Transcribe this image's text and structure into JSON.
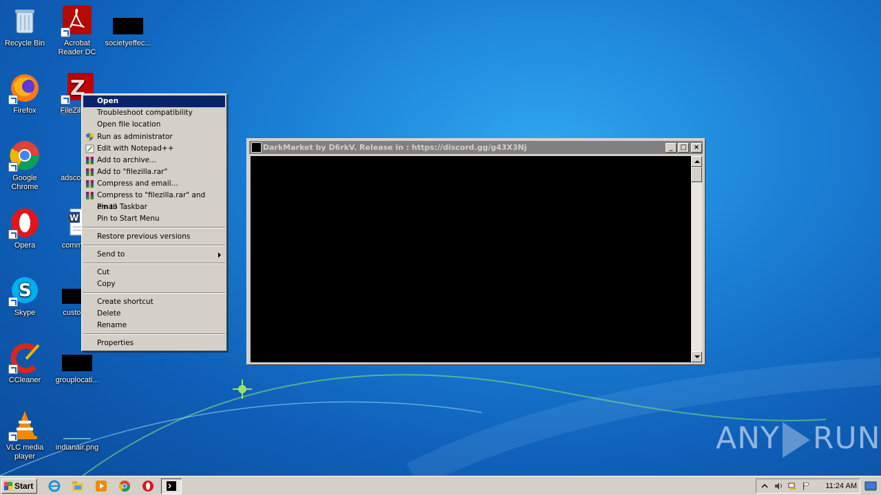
{
  "desktop": {
    "icons": [
      {
        "label": "Recycle Bin",
        "icon": "recycle-bin-icon"
      },
      {
        "label": "Acrobat Reader DC",
        "icon": "acrobat-icon"
      },
      {
        "label": "societyeffec...",
        "icon": "black-thumbnail-icon"
      },
      {
        "label": "Firefox",
        "icon": "firefox-icon"
      },
      {
        "label": "FileZilla C",
        "icon": "filezilla-icon"
      },
      {
        "label": "Google Chrome",
        "icon": "chrome-icon"
      },
      {
        "label": "adscomm",
        "icon": "blank-file-icon"
      },
      {
        "label": "Opera",
        "icon": "opera-icon"
      },
      {
        "label": "communi",
        "icon": "word-doc-icon"
      },
      {
        "label": "Skype",
        "icon": "skype-icon"
      },
      {
        "label": "customri",
        "icon": "black-thumbnail-icon"
      },
      {
        "label": "CCleaner",
        "icon": "ccleaner-icon"
      },
      {
        "label": "grouplocati...",
        "icon": "black-thumbnail-icon"
      },
      {
        "label": "VLC media player",
        "icon": "vlc-icon"
      },
      {
        "label": "indianair.png",
        "icon": "image-file-icon"
      }
    ]
  },
  "context_menu": {
    "items": [
      {
        "label": "Open",
        "active": true
      },
      {
        "label": "Troubleshoot compatibility"
      },
      {
        "label": "Open file location"
      },
      {
        "label": "Run as administrator",
        "icon": "uac-shield-icon"
      },
      {
        "label": "Edit with Notepad++",
        "icon": "notepadpp-icon"
      },
      {
        "label": "Add to archive...",
        "icon": "winrar-icon"
      },
      {
        "label": "Add to \"filezilla.rar\"",
        "icon": "winrar-icon"
      },
      {
        "label": "Compress and email...",
        "icon": "winrar-icon"
      },
      {
        "label": "Compress to \"filezilla.rar\" and email",
        "icon": "winrar-icon"
      },
      {
        "label": "Pin to Taskbar"
      },
      {
        "label": "Pin to Start Menu"
      },
      {
        "label": "Restore previous versions"
      },
      {
        "label": "Send to",
        "submenu": true
      },
      {
        "label": "Cut"
      },
      {
        "label": "Copy"
      },
      {
        "label": "Create shortcut"
      },
      {
        "label": "Delete"
      },
      {
        "label": "Rename"
      },
      {
        "label": "Properties"
      }
    ]
  },
  "console_window": {
    "title": "DarkMarket by D6rkV. Release in : https://discord.gg/g43X3Nj",
    "minimize": "_",
    "maximize": "□",
    "close": "×"
  },
  "taskbar": {
    "start_label": "Start",
    "clock": "11:24 AM",
    "pinned": [
      "internet-explorer-icon",
      "explorer-folder-icon",
      "media-player-icon",
      "chrome-icon",
      "opera-icon",
      "console-app-icon"
    ]
  },
  "watermark": {
    "left": "ANY",
    "right": "RUN"
  }
}
